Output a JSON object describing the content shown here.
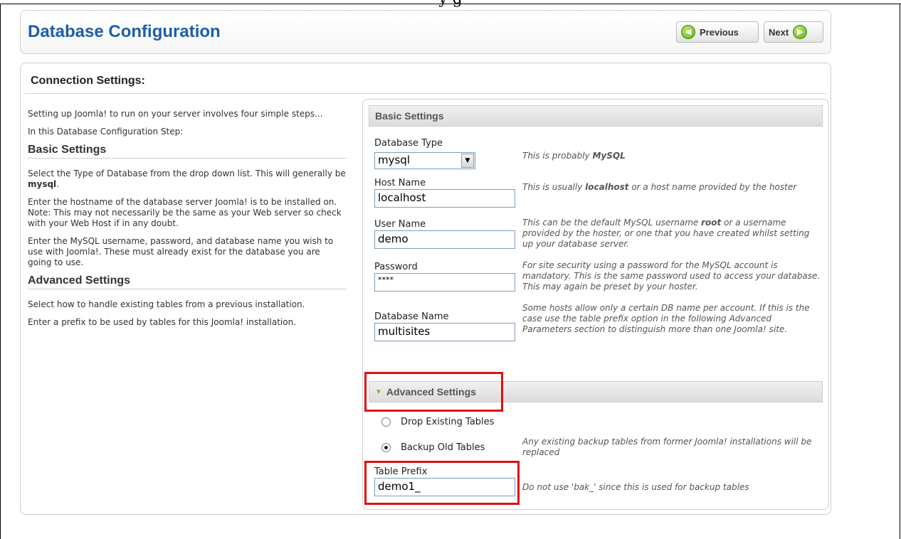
{
  "page": {
    "title": "Database Configuration",
    "previous_label": "Previous",
    "next_label": "Next",
    "cut_heading": "y                                                        g"
  },
  "connection": {
    "title": "Connection Settings:"
  },
  "left": {
    "intro": "Setting up Joomla! to run on your server involves four simple steps...",
    "step_text": "In this Database Configuration Step:",
    "basic_heading": "Basic Settings",
    "basic_p1_a": "Select the Type of Database from the drop down list. This will generally be ",
    "basic_p1_b": "mysql",
    "basic_p1_c": ".",
    "basic_p2": "Enter the hostname of the database server Joomla! is to be installed on. Note: This may not necessarily be the same as your Web server so check with your Web Host if in any doubt.",
    "basic_p3": "Enter the MySQL username, password, and database name you wish to use with Joomla!. These must already exist for the database you are going to use.",
    "advanced_heading": "Advanced Settings",
    "adv_p1": "Select how to handle existing tables from a previous installation.",
    "adv_p2": "Enter a prefix to be used by tables for this Joomla! installation."
  },
  "basic": {
    "heading": "Basic Settings",
    "db_type_label": "Database Type",
    "db_type_value": "mysql",
    "db_type_hint_a": "This is probably ",
    "db_type_hint_b": "MySQL",
    "host_label": "Host Name",
    "host_value": "localhost",
    "host_hint_a": "This is usually ",
    "host_hint_b": "localhost",
    "host_hint_c": " or a host name provided by the hoster",
    "user_label": "User Name",
    "user_value": "demo",
    "user_hint_a": "This can be the default MySQL username ",
    "user_hint_b": "root",
    "user_hint_c": " or a username provided by the hoster, or one that you have created whilst setting up your database server.",
    "password_label": "Password",
    "password_value": "****",
    "password_hint": "For site security using a password for the MySQL account is mandatory. This is the same password used to access your database. This may again be preset by your hoster.",
    "dbname_label": "Database Name",
    "dbname_value": "multisites",
    "dbname_hint": "Some hosts allow only a certain DB name per account. If this is the case use the table prefix option in the following Advanced Parameters section to distinguish more than one Joomla! site."
  },
  "advanced": {
    "heading": "Advanced Settings",
    "drop_label": "Drop Existing Tables",
    "backup_label": "Backup Old Tables",
    "backup_hint": "Any existing backup tables from former Joomla! installations will be replaced",
    "prefix_label": "Table Prefix",
    "prefix_value": "demo1_",
    "prefix_hint": "Do not use 'bak_' since this is used for backup tables"
  }
}
